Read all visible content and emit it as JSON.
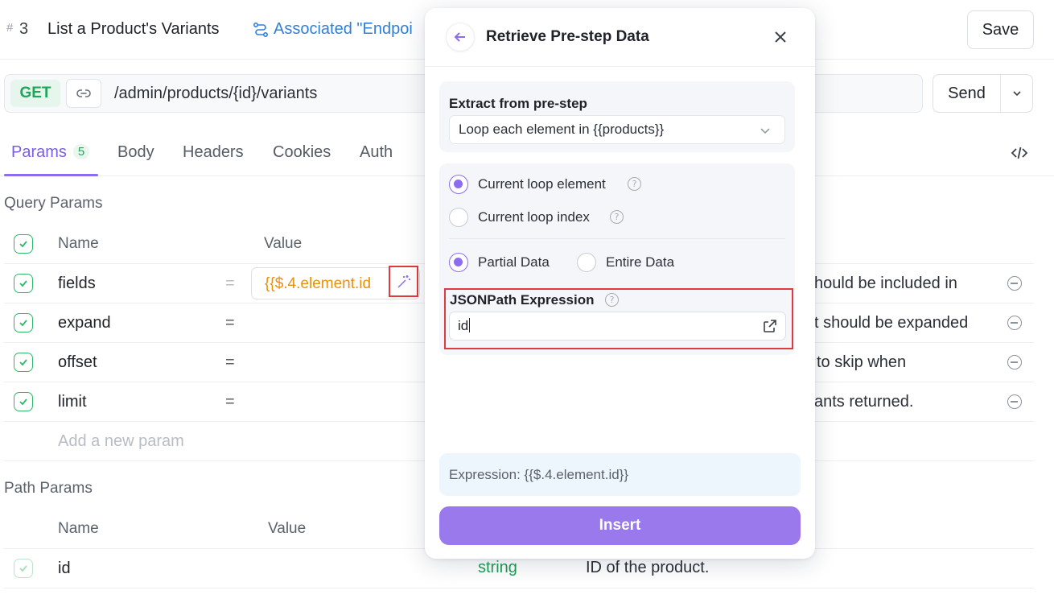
{
  "header": {
    "step_hash": "#",
    "step_number": "3",
    "step_title": "List a Product's Variants",
    "associated_label": "Associated \"Endpoi",
    "save_label": "Save"
  },
  "request": {
    "method": "GET",
    "url": "/admin/products/{id}/variants",
    "send_label": "Send"
  },
  "tabs": [
    {
      "label": "Params",
      "badge": "5"
    },
    {
      "label": "Body"
    },
    {
      "label": "Headers"
    },
    {
      "label": "Cookies"
    },
    {
      "label": "Auth"
    }
  ],
  "query_params": {
    "title": "Query Params",
    "col_name": "Name",
    "col_value": "Value",
    "rows": [
      {
        "name": "fields",
        "eq": "=",
        "value": "{{$.4.element.id",
        "description": "hould be included in"
      },
      {
        "name": "expand",
        "eq": "=",
        "value": "",
        "description": "t should be expanded"
      },
      {
        "name": "offset",
        "eq": "=",
        "value": "",
        "description": "to skip when"
      },
      {
        "name": "limit",
        "eq": "=",
        "value": "",
        "description": "ants returned."
      }
    ],
    "add_placeholder": "Add a new param"
  },
  "path_params": {
    "title": "Path Params",
    "col_name": "Name",
    "col_value": "Value",
    "rows": [
      {
        "name": "id",
        "type": "string",
        "description": "ID of the product."
      }
    ]
  },
  "modal": {
    "title": "Retrieve Pre-step Data",
    "extract_label": "Extract from pre-step",
    "extract_value": "Loop each element in {{products}}",
    "opt_current_element": "Current loop element",
    "opt_current_index": "Current loop index",
    "opt_partial": "Partial Data",
    "opt_entire": "Entire Data",
    "jsonpath_label": "JSONPath Expression",
    "jsonpath_value": "id",
    "expression_text": "Expression: {{$.4.element.id}}",
    "insert_label": "Insert"
  },
  "colors": {
    "accent": "#8c6df0",
    "insert_button": "#9a79ec",
    "method_get": "#1fa65b",
    "link": "#2f7fd8",
    "value_orange": "#e8900f",
    "highlight_red": "#e0393e"
  },
  "icons": [
    "flow-icon",
    "link-icon",
    "chevron-down-icon",
    "code-icon",
    "check-icon",
    "minus-circle-icon",
    "magic-wand-icon",
    "arrow-left-icon",
    "close-icon",
    "help-icon",
    "open-external-icon"
  ]
}
